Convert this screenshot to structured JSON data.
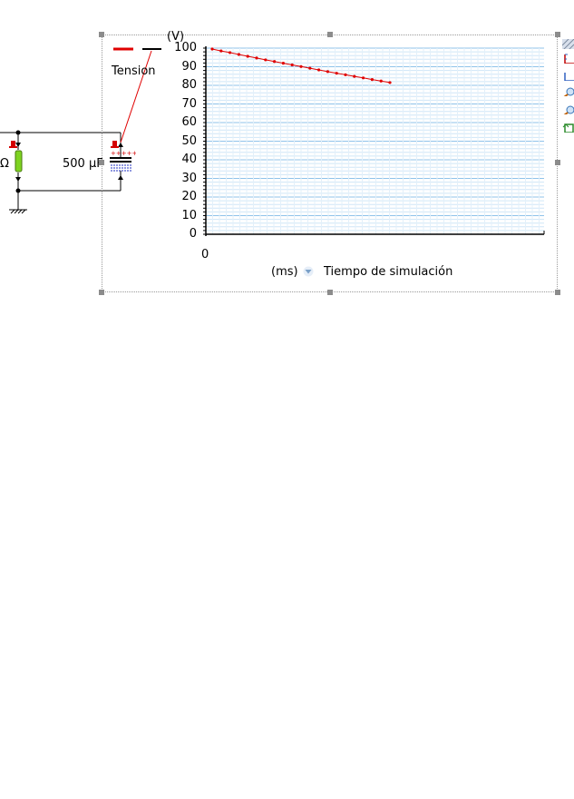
{
  "circuit": {
    "resistor_unit": "Ω",
    "capacitor_value": "500 µF"
  },
  "legend": {
    "series_label": "Tension",
    "series_color": "#e00000"
  },
  "graph": {
    "y_unit": "(V)",
    "x_unit": "(ms)",
    "x_axis_name": "Tiempo de simulación",
    "x_tick_zero": "0"
  },
  "toolbar": {
    "icons": [
      "pattern-icon",
      "axis-select-icon",
      "axis-select-small-icon",
      "zoom-in-icon",
      "zoom-out-icon",
      "reset-view-icon"
    ]
  },
  "chart_data": {
    "type": "line",
    "ylabel": "(V)",
    "xlabel": "(ms) Tiempo de simulación",
    "ylim": [
      0,
      100
    ],
    "y_ticks": [
      "100",
      "90",
      "80",
      "70",
      "60",
      "50",
      "40",
      "30",
      "20",
      "10",
      "0"
    ],
    "x_ticks": [
      "0"
    ],
    "series": [
      {
        "name": "Tension",
        "color": "#e00000",
        "x": [
          0,
          1,
          2,
          3,
          4,
          5,
          6,
          7,
          8,
          9,
          10,
          11,
          12,
          13,
          14,
          15,
          16,
          17,
          18,
          19,
          20
        ],
        "y": [
          99.5,
          98.5,
          97.6,
          96.6,
          95.6,
          94.7,
          93.7,
          92.8,
          91.9,
          91.0,
          90.1,
          89.2,
          88.3,
          87.4,
          86.5,
          85.7,
          84.8,
          84.0,
          83.1,
          82.3,
          81.5
        ]
      }
    ],
    "grid": true
  }
}
